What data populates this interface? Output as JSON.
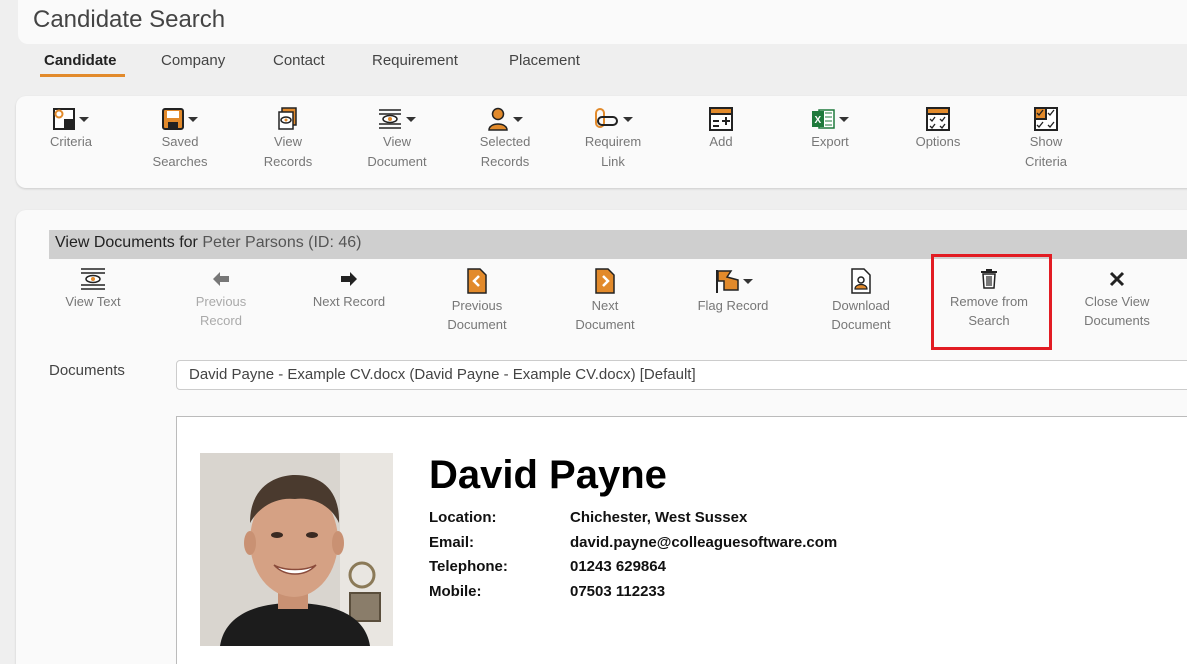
{
  "header": {
    "title": "Candidate Search"
  },
  "tabs": [
    {
      "label": "Candidate"
    },
    {
      "label": "Company"
    },
    {
      "label": "Contact"
    },
    {
      "label": "Requirement"
    },
    {
      "label": "Placement"
    }
  ],
  "toolbar": {
    "items": [
      {
        "label": "Criteria",
        "icon": "criteria-icon"
      },
      {
        "label": "Saved\nSearches",
        "icon": "save-icon"
      },
      {
        "label": "View\nRecords",
        "icon": "view-records-icon"
      },
      {
        "label": "View\nDocument",
        "icon": "view-document-icon"
      },
      {
        "label": "Selected\nRecords",
        "icon": "person-icon"
      },
      {
        "label": "Requirem\nLink",
        "icon": "link-icon"
      },
      {
        "label": "Add",
        "icon": "add-icon"
      },
      {
        "label": "Export",
        "icon": "excel-icon"
      },
      {
        "label": "Options",
        "icon": "options-icon"
      },
      {
        "label": "Show\nCriteria",
        "icon": "show-criteria-icon"
      }
    ]
  },
  "view_documents": {
    "prefix": "View Documents for",
    "candidate": "Peter Parsons (ID: 46)"
  },
  "actions": [
    {
      "label": "View Text",
      "icon": "view-text-icon"
    },
    {
      "label": "Previous\nRecord",
      "icon": "arrow-left-icon"
    },
    {
      "label": "Next Record",
      "icon": "arrow-right-icon"
    },
    {
      "label": "Previous\nDocument",
      "icon": "doc-prev-icon"
    },
    {
      "label": "Next\nDocument",
      "icon": "doc-next-icon"
    },
    {
      "label": "Flag Record",
      "icon": "flag-icon"
    },
    {
      "label": "Download\nDocument",
      "icon": "download-doc-icon"
    },
    {
      "label": "Remove from\nSearch",
      "icon": "trash-icon"
    },
    {
      "label": "Close View\nDocuments",
      "icon": "close-icon"
    }
  ],
  "documents": {
    "label": "Documents",
    "selected": "David Payne - Example CV.docx (David Payne - Example CV.docx) [Default]"
  },
  "cv": {
    "name": "David Payne",
    "rows": [
      {
        "key": "Location:",
        "value": "Chichester, West Sussex"
      },
      {
        "key": "Email:",
        "value": "david.payne@colleaguesoftware.com"
      },
      {
        "key": "Telephone:",
        "value": "01243 629864"
      },
      {
        "key": "Mobile:",
        "value": "07503 112233"
      }
    ]
  },
  "colors": {
    "accent": "#e28a2b",
    "highlight": "#e21c23",
    "excel": "#1f7a3c"
  }
}
